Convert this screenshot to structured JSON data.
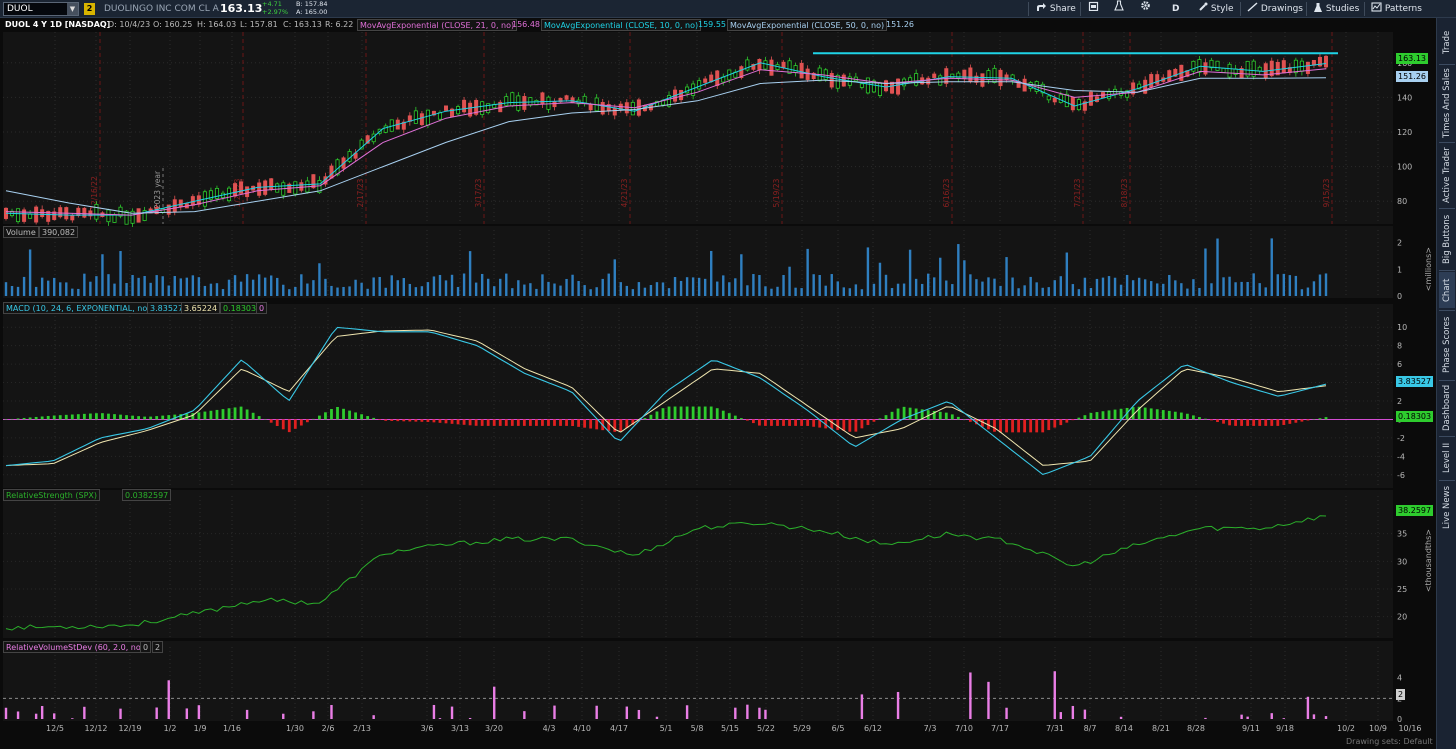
{
  "toolbar": {
    "symbol": "DUOL",
    "link_number": "2",
    "company": "DUOLINGO INC COM CL A",
    "last_price": "163.13",
    "change": "+4.71",
    "change_pct": "+2.97%",
    "bid": "B: 157.84",
    "ask": "A: 165.00",
    "share_label": "Share",
    "period_label": "D",
    "style_label": "Style",
    "drawings_label": "Drawings",
    "studies_label": "Studies",
    "patterns_label": "Patterns"
  },
  "price_panel": {
    "title": "DUOL 4 Y 1D [NASDAQ]",
    "date": "D: 10/4/23",
    "open": "O: 160.25",
    "high": "H: 164.03",
    "low": "L: 157.81",
    "close": "C: 163.13",
    "range": "R: 6.22",
    "ema21_label": "MovAvgExponential (CLOSE, 21, 0, no)",
    "ema21_value": "156.48",
    "ema10_label": "MovAvgExponential (CLOSE, 10, 0, no)",
    "ema10_value": "159.55",
    "ema50_label": "MovAvgExponential (CLOSE, 50, 0, no)",
    "ema50_value": "151.26",
    "last_tag": "163.13",
    "ema50_tag": "151.26",
    "y_ticks": [
      "160",
      "140",
      "120",
      "100",
      "80"
    ],
    "year_marker": "2023 year",
    "event_dates": [
      "12/16/22",
      "1/27/23",
      "2/17/23",
      "3/17/23",
      "4/21/23",
      "5/19/23",
      "6/16/23",
      "7/21/23",
      "8/18/23",
      "9/15/23"
    ],
    "resistance_color": "#1fd3e6"
  },
  "volume_panel": {
    "label": "Volume",
    "value": "390,082",
    "y_ticks": [
      "2",
      "1",
      "0"
    ],
    "unit": "<millions>"
  },
  "macd_panel": {
    "label": "MACD (10, 24, 6, EXPONENTIAL, no)",
    "value": "3.83527",
    "avg": "3.65224",
    "diff": "0.18303",
    "zero": "0",
    "y_ticks": [
      "10",
      "8",
      "6",
      "4",
      "2",
      "0",
      "-2",
      "-4",
      "-6"
    ],
    "value_tag": "3.83527",
    "diff_tag": "0.18303"
  },
  "rs_panel": {
    "label": "RelativeStrength (SPX)",
    "value": "0.0382597",
    "y_ticks": [
      "35",
      "30",
      "25",
      "20"
    ],
    "tag": "38.2597",
    "unit": "<thousandths>"
  },
  "rvsd_panel": {
    "label": "RelativeVolumeStDev (60, 2.0, no)",
    "v1": "0",
    "v2": "2",
    "y_ticks": [
      "4",
      "2",
      "0"
    ],
    "tag": "2"
  },
  "x_axis": {
    "labels": [
      "12/5",
      "12/12",
      "12/19",
      "1/2",
      "1/9",
      "1/16",
      "1/30",
      "2/6",
      "2/13",
      "3/6",
      "3/13",
      "3/20",
      "4/3",
      "4/10",
      "4/17",
      "5/1",
      "5/8",
      "5/15",
      "5/22",
      "5/29",
      "6/5",
      "6/12",
      "7/3",
      "7/10",
      "7/17",
      "7/31",
      "8/7",
      "8/14",
      "8/21",
      "8/28",
      "9/11",
      "9/18",
      "10/2",
      "10/9",
      "10/16"
    ]
  },
  "sidebar": {
    "tabs": [
      "Trade",
      "Times And Sales",
      "Active Trader",
      "Big Buttons",
      "Chart",
      "Phase Scores",
      "Dashboard",
      "Level II",
      "Live News"
    ]
  },
  "status": {
    "text": "Drawing sets: Default"
  },
  "colors": {
    "up": "#2ecc2e",
    "down": "#e05252",
    "ema10": "#1fd3e6",
    "ema21": "#e070d8",
    "ema50": "#a8d0f0",
    "volume": "#2f7fc0",
    "macd_line": "#39c8e6",
    "macd_avg": "#f0e6b0",
    "rs_line": "#2bb02b",
    "rvsd_bar": "#ea7ee6"
  },
  "chart_data": [
    {
      "type": "line",
      "panel": "price",
      "x": [
        "12/5",
        "12/19",
        "1/2",
        "1/16",
        "1/30",
        "2/13",
        "3/6",
        "3/20",
        "4/3",
        "4/17",
        "5/1",
        "5/15",
        "5/29",
        "6/12",
        "7/3",
        "7/17",
        "7/31",
        "8/14",
        "8/28",
        "9/11",
        "9/18",
        "10/2"
      ],
      "series": [
        {
          "name": "EMA 10",
          "values": [
            73,
            72,
            72,
            80,
            88,
            90,
            122,
            132,
            137,
            138,
            132,
            146,
            160,
            152,
            146,
            152,
            151,
            135,
            145,
            158,
            155,
            159.6
          ]
        },
        {
          "name": "EMA 21",
          "values": [
            74,
            73,
            72,
            78,
            86,
            89,
            114,
            128,
            135,
            137,
            134,
            143,
            156,
            153,
            148,
            151,
            150,
            140,
            143,
            155,
            153,
            156.5
          ]
        },
        {
          "name": "EMA 50",
          "values": [
            86,
            79,
            73,
            74,
            80,
            86,
            100,
            114,
            126,
            131,
            133,
            138,
            148,
            150,
            148,
            149,
            149,
            144,
            143,
            151,
            151,
            151.3
          ]
        }
      ],
      "ylim": [
        68,
        172
      ],
      "resistance": 165.5
    },
    {
      "type": "line",
      "panel": "relative_strength",
      "x": [
        "12/5",
        "12/19",
        "1/2",
        "1/16",
        "1/30",
        "2/13",
        "3/6",
        "3/20",
        "4/3",
        "4/17",
        "5/1",
        "5/15",
        "5/29",
        "6/12",
        "7/3",
        "7/17",
        "7/31",
        "8/14",
        "8/28",
        "9/11",
        "9/18",
        "10/2"
      ],
      "values": [
        18,
        18.2,
        18.5,
        20.5,
        23,
        22.5,
        31.5,
        33,
        34,
        34,
        31,
        36,
        37,
        35.5,
        33,
        35,
        33.5,
        29,
        33,
        36,
        36,
        38.26
      ],
      "ylim": [
        16.5,
        40
      ]
    }
  ]
}
